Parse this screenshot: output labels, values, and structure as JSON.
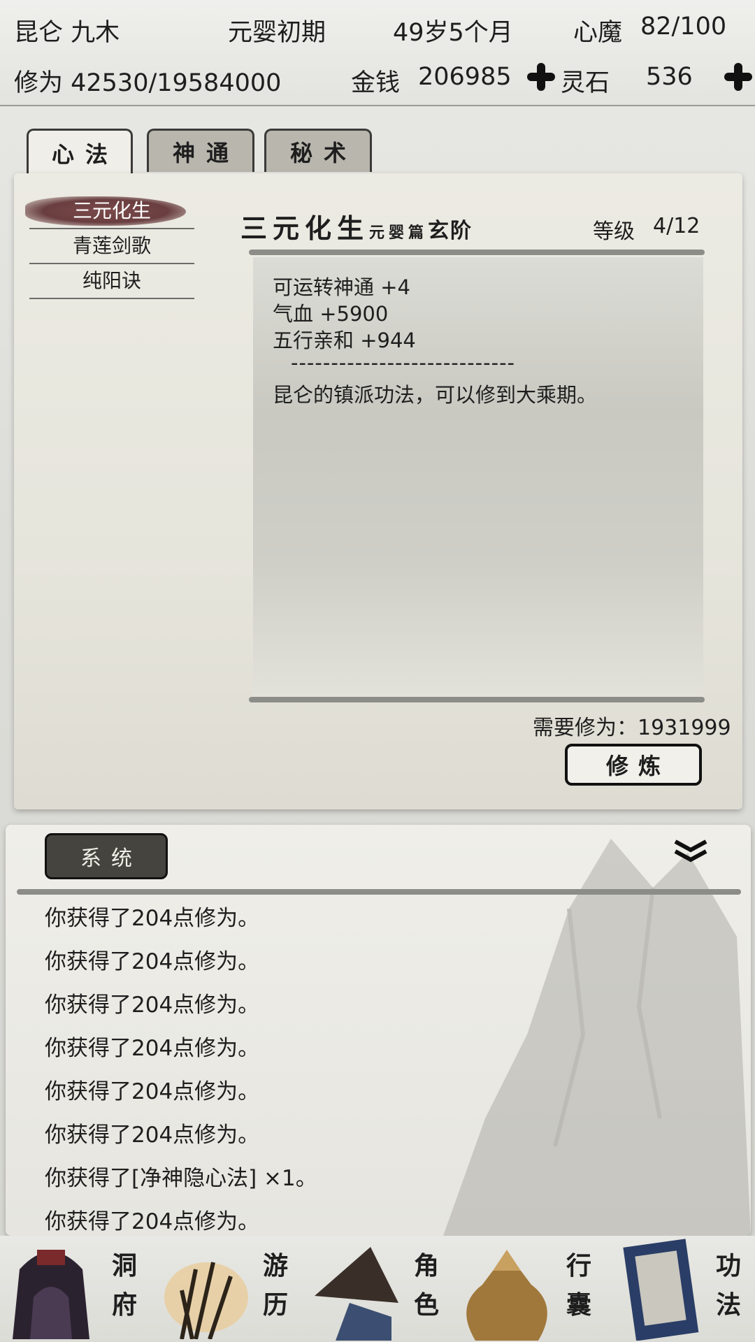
{
  "status": {
    "name": "昆仑 九木",
    "realm": "元婴初期",
    "age": "49岁5个月",
    "demon_label": "心魔",
    "demon_value": "82/100",
    "cultivation": "修为 42530/19584000",
    "money_label": "金钱",
    "money_value": "206985",
    "stone_label": "灵石",
    "stone_value": "536"
  },
  "tabs": [
    {
      "label": "心法",
      "active": true
    },
    {
      "label": "神通",
      "active": false
    },
    {
      "label": "秘术",
      "active": false
    }
  ],
  "skills": [
    {
      "name": "三元化生",
      "selected": true
    },
    {
      "name": "青莲剑歌",
      "selected": false
    },
    {
      "name": "纯阳诀",
      "selected": false
    }
  ],
  "detail": {
    "title": "三元化生",
    "chapter": "元婴篇",
    "grade": "玄阶",
    "level_label": "等级",
    "level_value": "4/12",
    "effects": [
      "可运转神通 +4",
      "气血 +5900",
      "五行亲和 +944"
    ],
    "divider": "----------------------------",
    "description": "昆仑的镇派功法，可以修到大乘期。",
    "requirement": "需要修为：1931999",
    "practice_button": "修炼"
  },
  "log": {
    "tab_label": "系统",
    "lines": [
      "你获得了204点修为。",
      "你获得了204点修为。",
      "你获得了204点修为。",
      "你获得了204点修为。",
      "你获得了204点修为。",
      "你获得了204点修为。",
      "你获得了[净神隐心法] ×1。",
      "你获得了204点修为。"
    ]
  },
  "nav": [
    {
      "label": "洞府",
      "icon": "cave-dwelling-icon"
    },
    {
      "label": "游历",
      "icon": "travel-grass-icon"
    },
    {
      "label": "角色",
      "icon": "straw-hat-character-icon"
    },
    {
      "label": "行囊",
      "icon": "bag-icon"
    },
    {
      "label": "功法",
      "icon": "scroll-book-icon"
    }
  ],
  "colors": {
    "selected_brush": "#6a3e40",
    "button_border": "#111111",
    "panel": "#ecebe3"
  }
}
